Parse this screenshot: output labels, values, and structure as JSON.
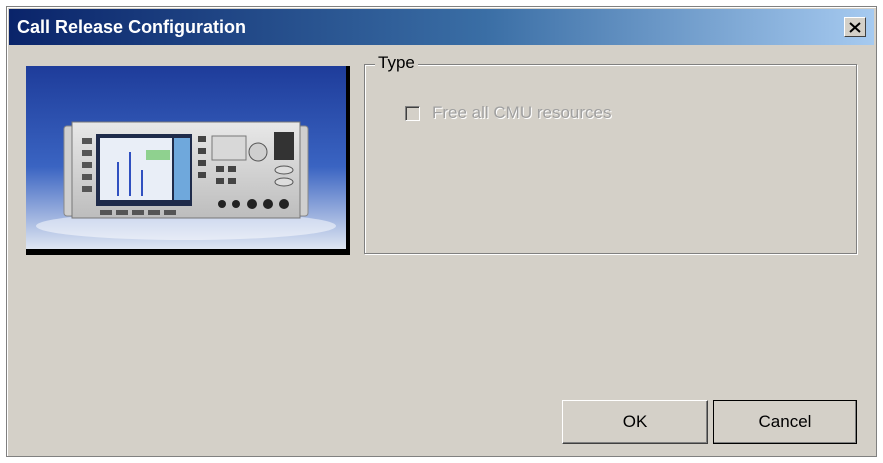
{
  "dialog": {
    "title": "Call Release Configuration",
    "close_symbol": "×"
  },
  "type_group": {
    "legend": "Type",
    "checkbox": {
      "label": "Free all CMU resources",
      "checked": false,
      "enabled": false
    }
  },
  "buttons": {
    "ok_label": "OK",
    "cancel_label": "Cancel"
  },
  "colors": {
    "title_gradient_start": "#0a246a",
    "title_gradient_end": "#a6caf0",
    "dialog_face": "#d4d0c8",
    "disabled_text": "#a0a0a0"
  },
  "image": {
    "semantic": "instrument-photo"
  }
}
